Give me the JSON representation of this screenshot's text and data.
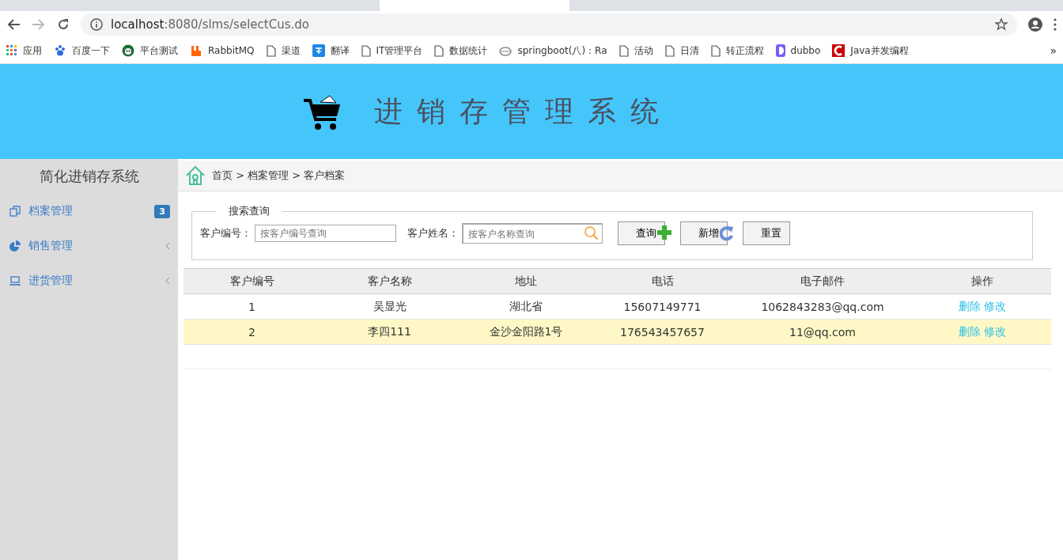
{
  "browser": {
    "url_host": "localhost",
    "url_rest": ":8080/slms/selectCus.do",
    "bookmarks": [
      {
        "kind": "apps",
        "label": "应用"
      },
      {
        "kind": "paw",
        "label": "百度一下"
      },
      {
        "kind": "panda",
        "label": "平台测试"
      },
      {
        "kind": "rabbit",
        "label": "RabbitMQ"
      },
      {
        "kind": "page",
        "label": "渠道"
      },
      {
        "kind": "translate",
        "label": "翻译"
      },
      {
        "kind": "page",
        "label": "IT管理平台"
      },
      {
        "kind": "page",
        "label": "数据统计"
      },
      {
        "kind": "cloud",
        "label": "springboot(八)：Ra"
      },
      {
        "kind": "page",
        "label": "活动"
      },
      {
        "kind": "page",
        "label": "日清"
      },
      {
        "kind": "page",
        "label": "转正流程"
      },
      {
        "kind": "dubbo",
        "label": "dubbo"
      },
      {
        "kind": "csdn",
        "label": "Java并发编程"
      }
    ],
    "more": "»"
  },
  "header": {
    "title": "进销存管理系统"
  },
  "sidebar": {
    "title": "简化进销存系统",
    "items": [
      {
        "kind": "archive",
        "label": "档案管理",
        "badge": "3"
      },
      {
        "kind": "pie",
        "label": "销售管理"
      },
      {
        "kind": "laptop",
        "label": "进货管理"
      }
    ]
  },
  "breadcrumb": "首页 > 档案管理 > 客户档案",
  "search": {
    "legend": "搜索查询",
    "id_label": "客户编号：",
    "id_placeholder": "按客户编号查询",
    "name_label": "客户姓名：",
    "name_placeholder": "按客户名称查询",
    "buttons": [
      {
        "kind": "query",
        "label": "查询"
      },
      {
        "kind": "add",
        "label": "新增"
      },
      {
        "kind": "reset",
        "label": "重置"
      }
    ]
  },
  "table": {
    "columns": [
      "客户编号",
      "客户名称",
      "地址",
      "电话",
      "电子邮件",
      "操作"
    ],
    "rows": [
      {
        "selected": false,
        "cells": [
          "1",
          "吴显光",
          "湖北省",
          "15607149771",
          "1062843283@qq.com"
        ],
        "actions": [
          "删除",
          "修改"
        ]
      },
      {
        "selected": true,
        "cells": [
          "2",
          "李四111",
          "金沙金阳路1号",
          "176543457657",
          "11@qq.com"
        ],
        "actions": [
          "删除",
          "修改"
        ]
      }
    ]
  }
}
